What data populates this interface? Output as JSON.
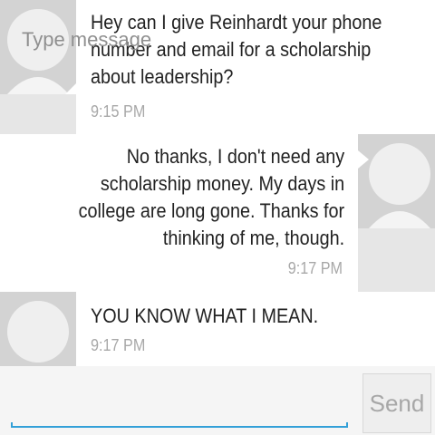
{
  "colors": {
    "background": "#e6e6e6",
    "bubble": "#ffffff",
    "avatar_bg": "#d3d3d3",
    "avatar_fg": "#f4f4f4",
    "accent": "#33a0d8",
    "timestamp": "#a8a8a8"
  },
  "messages": [
    {
      "direction": "incoming",
      "avatar_icon": "default-contact-icon",
      "lines": [
        "Hey can I give Reinhardt your phone",
        "number and email for a scholarship",
        "about leadership?"
      ],
      "time": "9:15 PM"
    },
    {
      "direction": "outgoing",
      "avatar_icon": "default-contact-icon",
      "lines": [
        "No thanks, I don't need any",
        "scholarship money.  My days in",
        "college are long gone.  Thanks for",
        "thinking of me, though."
      ],
      "time": "9:17 PM"
    },
    {
      "direction": "incoming",
      "avatar_icon": "default-contact-icon",
      "lines": [
        "YOU KNOW WHAT I MEAN."
      ],
      "time": "9:17 PM"
    }
  ],
  "compose": {
    "placeholder": "Type message",
    "value": "",
    "send_label": "Send"
  }
}
